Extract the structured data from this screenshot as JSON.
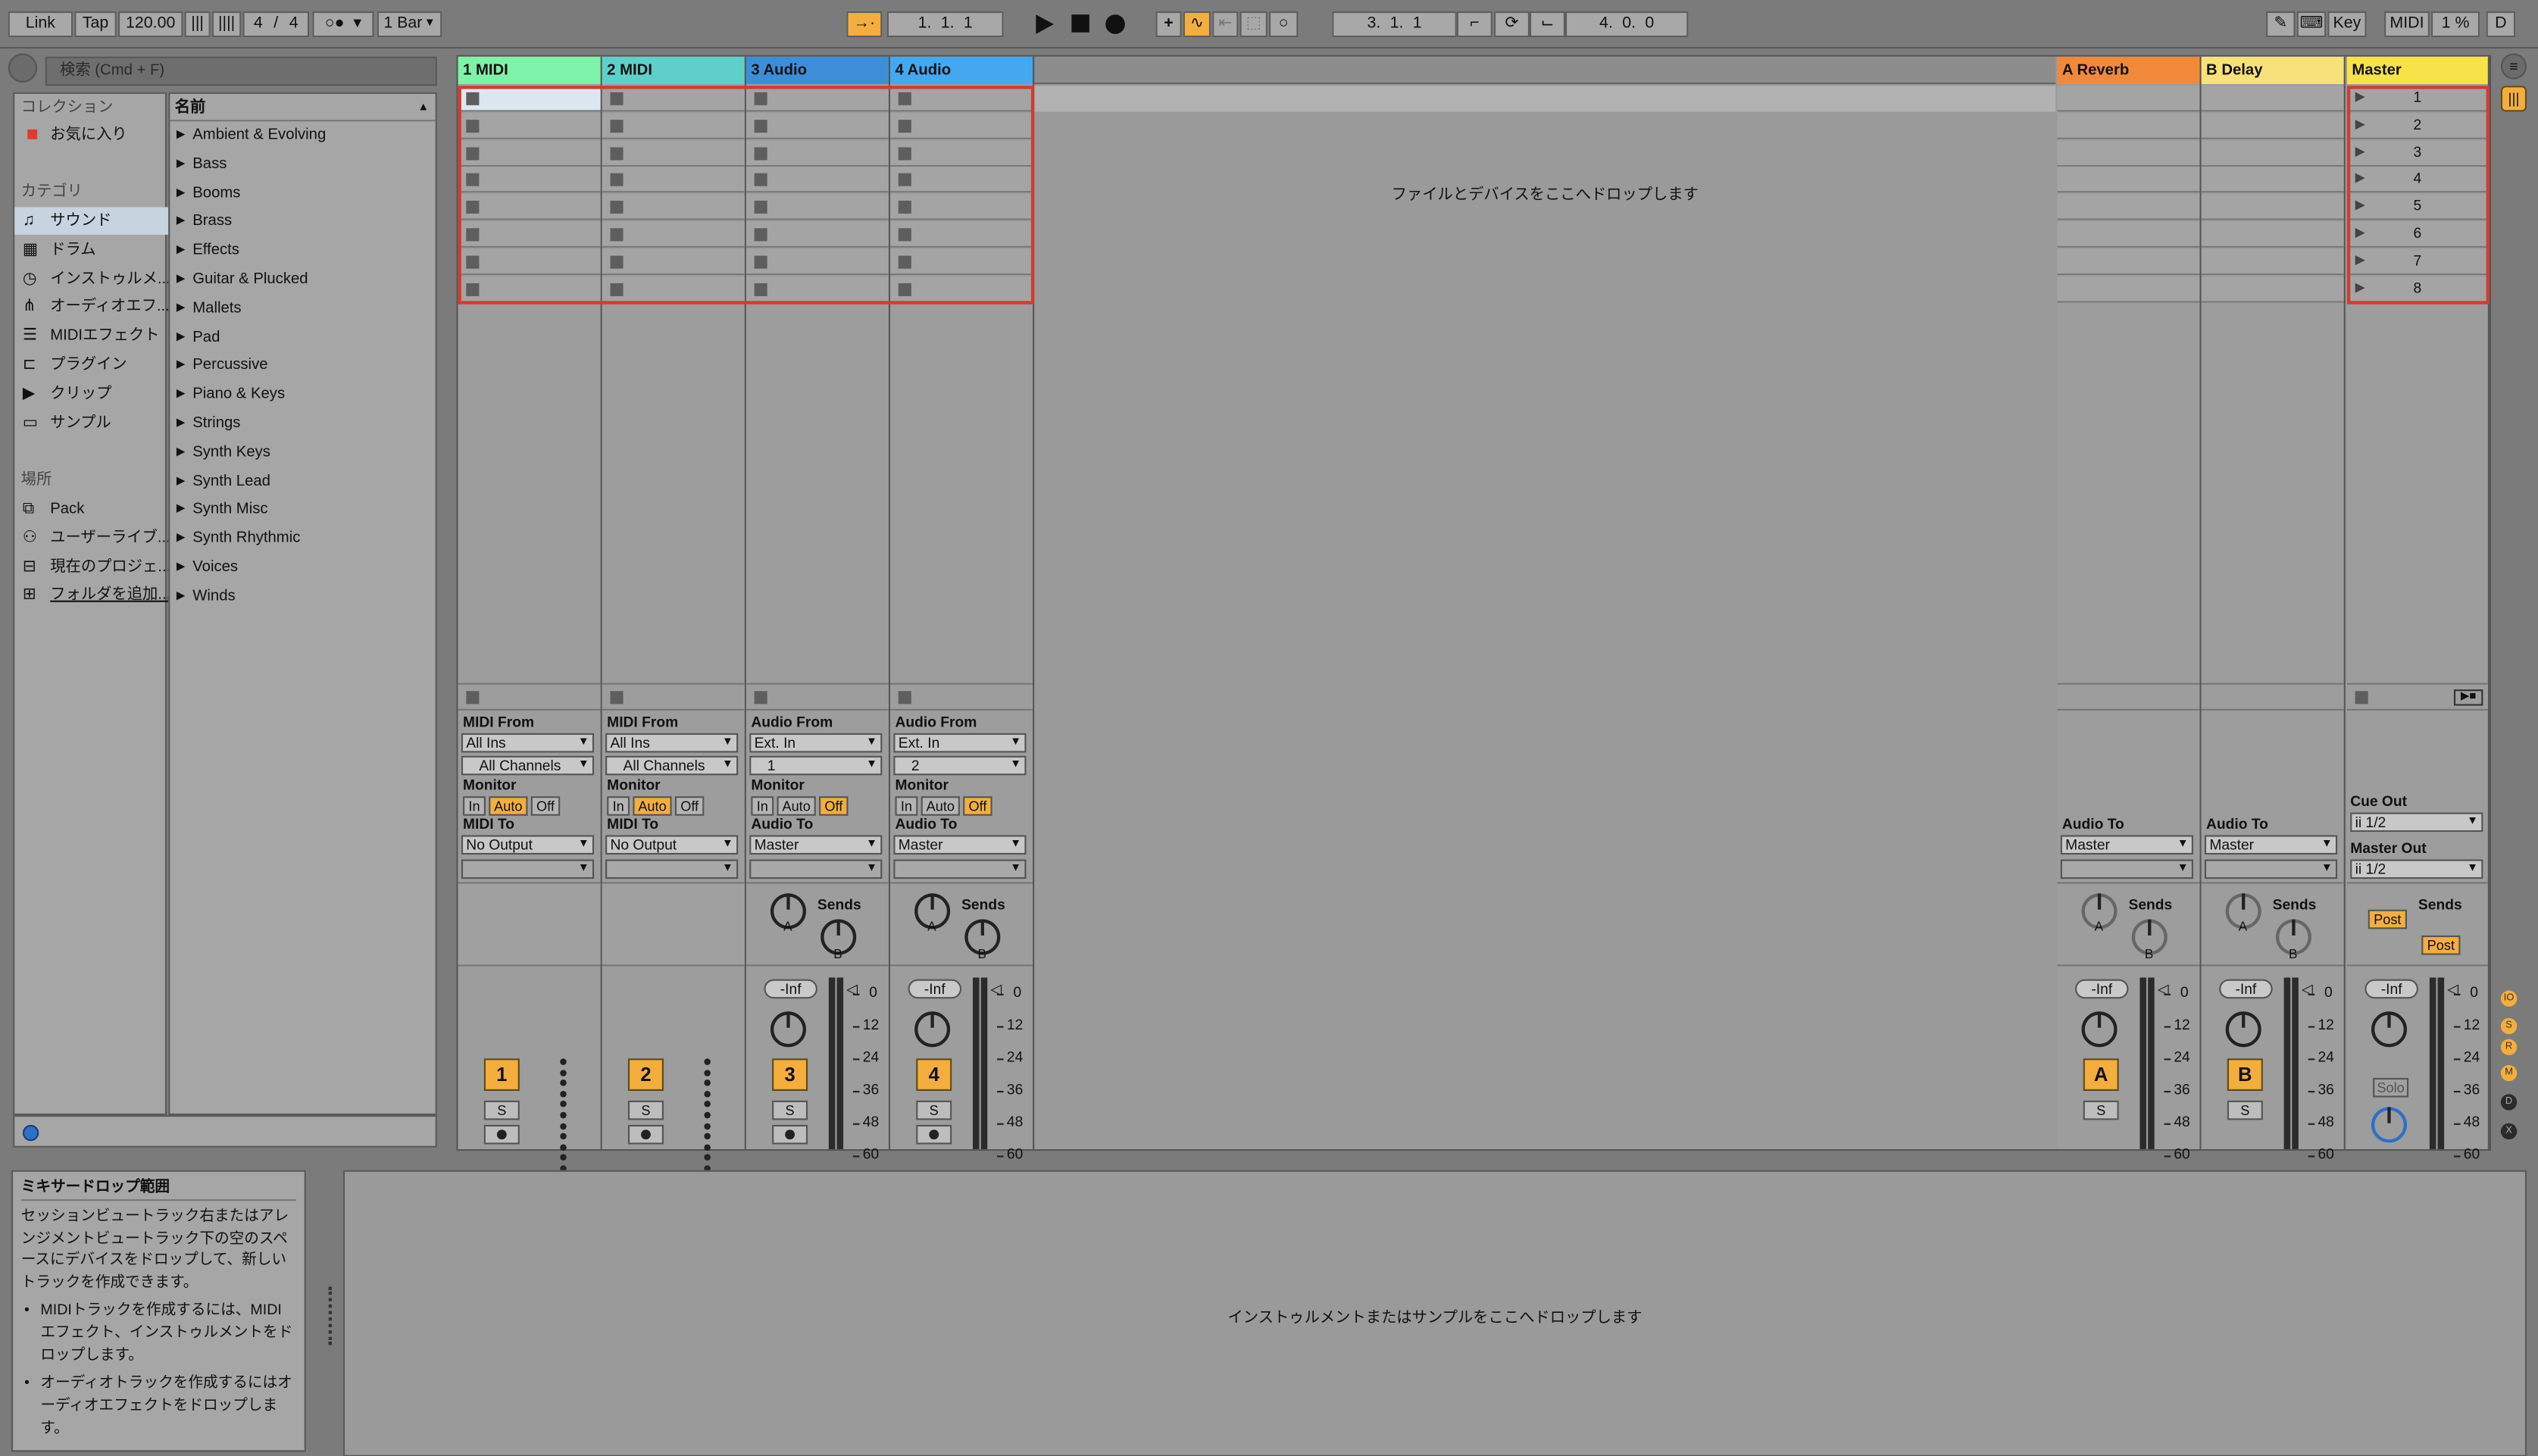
{
  "toolbar": {
    "link": "Link",
    "tap": "Tap",
    "tempo": "120.00",
    "signature_num": "4",
    "signature_slash": "/",
    "signature_den": "4",
    "quantize": "1 Bar",
    "position": "1.  1.  1",
    "loop_start": "3.  1.  1",
    "loop_length": "4.  0.  0",
    "key": "Key",
    "midi": "MIDI",
    "cpu": "1 %",
    "disk": "D"
  },
  "browser": {
    "search_placeholder": "検索 (Cmd + F)",
    "collections_heading": "コレクション",
    "favorites": "お気に入り",
    "categories_heading": "カテゴリ",
    "categories": [
      "サウンド",
      "ドラム",
      "インストゥルメ...",
      "オーディオエフ...",
      "MIDIエフェクト",
      "プラグイン",
      "クリップ",
      "サンプル"
    ],
    "places_heading": "場所",
    "places": [
      "Pack",
      "ユーザーライブ...",
      "現在のプロジェ...",
      "フォルダを追加..."
    ],
    "name_heading": "名前",
    "items": [
      "Ambient & Evolving",
      "Bass",
      "Booms",
      "Brass",
      "Effects",
      "Guitar & Plucked",
      "Mallets",
      "Pad",
      "Percussive",
      "Piano & Keys",
      "Strings",
      "Synth Keys",
      "Synth Lead",
      "Synth Misc",
      "Synth Rhythmic",
      "Voices",
      "Winds"
    ]
  },
  "tracks": [
    {
      "name": "1 MIDI",
      "color": "#7ef2a8",
      "from_label": "MIDI From",
      "from": "All Ins",
      "channel": "All Channels",
      "monitor": "Monitor",
      "to_label": "MIDI To",
      "to": "No Output",
      "number": "1",
      "solo": "S",
      "type": "midi"
    },
    {
      "name": "2 MIDI",
      "color": "#5fd0c9",
      "from_label": "MIDI From",
      "from": "All Ins",
      "channel": "All Channels",
      "monitor": "Monitor",
      "to_label": "MIDI To",
      "to": "No Output",
      "number": "2",
      "solo": "S",
      "type": "midi"
    },
    {
      "name": "3 Audio",
      "color": "#3d8ed8",
      "from_label": "Audio From",
      "from": "Ext. In",
      "channel": "1",
      "monitor": "Monitor",
      "to_label": "Audio To",
      "to": "Master",
      "number": "3",
      "solo": "S",
      "type": "audio"
    },
    {
      "name": "4 Audio",
      "color": "#44a8f0",
      "from_label": "Audio From",
      "from": "Ext. In",
      "channel": "2",
      "monitor": "Monitor",
      "to_label": "Audio To",
      "to": "Master",
      "number": "4",
      "solo": "S",
      "type": "audio"
    }
  ],
  "returns": [
    {
      "name": "A Reverb",
      "color": "#f08a3a",
      "to_label": "Audio To",
      "to": "Master",
      "letter": "A",
      "solo": "S"
    },
    {
      "name": "B Delay",
      "color": "#f7e27a",
      "to_label": "Audio To",
      "to": "Master",
      "letter": "B",
      "solo": "S"
    }
  ],
  "master": {
    "name": "Master",
    "color": "#f7e24a",
    "scenes": [
      "1",
      "2",
      "3",
      "4",
      "5",
      "6",
      "7",
      "8"
    ],
    "cue_out_label": "Cue Out",
    "cue_out": "ii 1/2",
    "master_out_label": "Master Out",
    "master_out": "ii 1/2",
    "solo": "Solo",
    "post": "Post"
  },
  "mixer": {
    "sends": "Sends",
    "send_a": "A",
    "send_b": "B",
    "inf": "-Inf",
    "monitor_in": "In",
    "monitor_auto": "Auto",
    "monitor_off": "Off",
    "scale": [
      "0",
      "12",
      "24",
      "36",
      "48",
      "60"
    ]
  },
  "drop_zone": {
    "main": "ファイルとデバイスをここへドロップします",
    "device": "インストゥルメントまたはサンプルをここへドロップします"
  },
  "info": {
    "title": "ミキサードロップ範囲",
    "body": "セッションビュートラック右またはアレンジメントビュートラック下の空のスペースにデバイスをドロップして、新しいトラックを作成できます。",
    "bullets": [
      "MIDIトラックを作成するには、MIDIエフェクト、インストゥルメントをドロップします。",
      "オーディオトラックを作成するにはオーディオエフェクトをドロップします。"
    ]
  },
  "side_indicators": [
    "IO",
    "S",
    "R",
    "M",
    "D",
    "X"
  ]
}
